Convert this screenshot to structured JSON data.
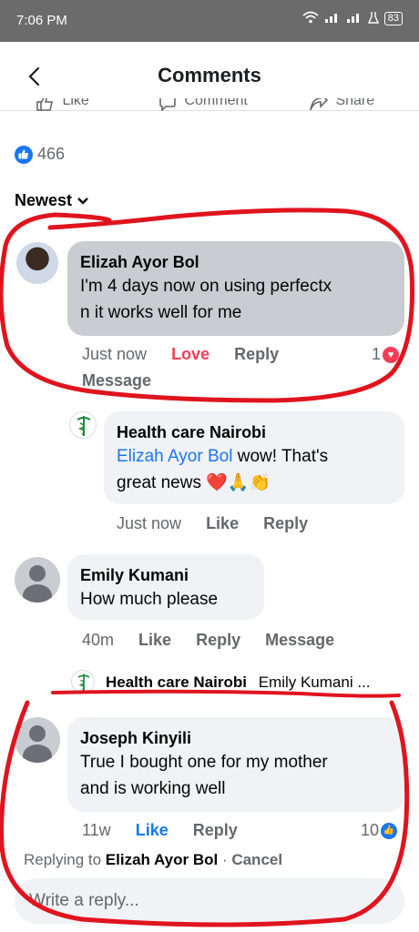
{
  "status_bar": {
    "time": "7:06 PM",
    "battery": "83"
  },
  "header": {
    "title": "Comments"
  },
  "top_actions": {
    "like": "Like",
    "comment": "Comment",
    "share": "Share"
  },
  "post": {
    "reaction_count": "466"
  },
  "sort": {
    "label": "Newest"
  },
  "comments": [
    {
      "author": "Elizah Ayor Bol",
      "text_line1": "I'm 4 days now on using perfectx",
      "text_line2": "n it works well for me",
      "time": "Just now",
      "reaction_action": "Love",
      "reply_label": "Reply",
      "message_label": "Message",
      "reaction_count": "1"
    },
    {
      "author": "Health care Nairobi",
      "mention": "Elizah Ayor Bol",
      "text_after_mention": " wow! That's",
      "text_line2": "great news",
      "emoji": "❤️🙏👏",
      "time": "Just now",
      "like_label": "Like",
      "reply_label": "Reply"
    },
    {
      "author": "Emily Kumani",
      "text": "How much please",
      "time": "40m",
      "like_label": "Like",
      "reply_label": "Reply",
      "message_label": "Message"
    },
    {
      "author": "Joseph Kinyili",
      "text_line1": "True I bought one for my mother",
      "text_line2": "and is working well",
      "time": "11w",
      "like_label": "Like",
      "reply_label": "Reply",
      "reaction_count": "10"
    }
  ],
  "reply_summary": {
    "author": "Health care Nairobi",
    "mention": "Emily Kumani ..."
  },
  "replying_bar": {
    "prefix": "Replying to ",
    "name": "Elizah Ayor Bol",
    "separator": " · ",
    "cancel": "Cancel"
  },
  "composer": {
    "placeholder": "Write a reply..."
  },
  "colors": {
    "accent": "#1877f2",
    "love": "#f33e58",
    "annotation": "#e0141e"
  }
}
